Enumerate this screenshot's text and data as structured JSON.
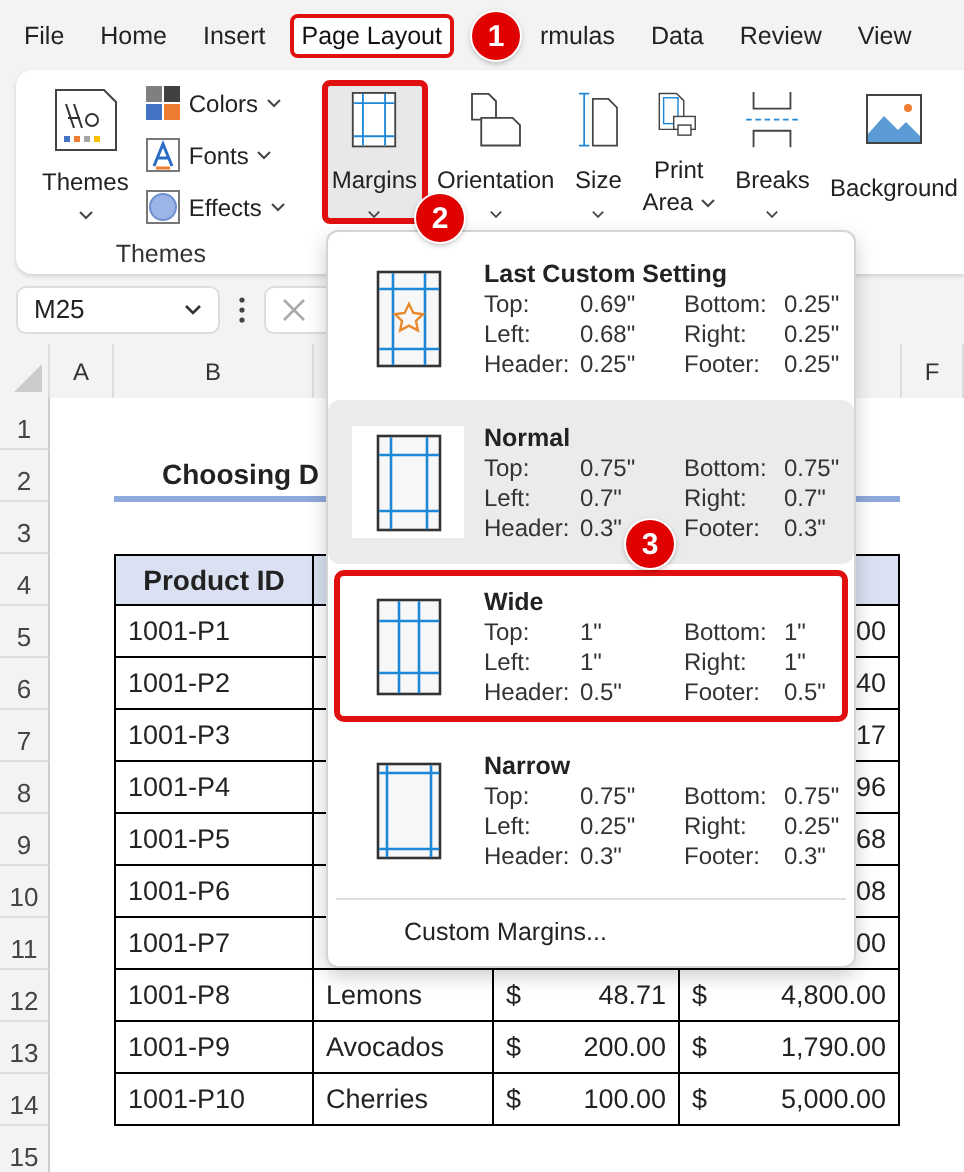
{
  "tabs": [
    {
      "label": "File",
      "selected": false,
      "highlighted": false
    },
    {
      "label": "Home",
      "selected": false,
      "highlighted": false
    },
    {
      "label": "Insert",
      "selected": false,
      "highlighted": false
    },
    {
      "label": "Page Layout",
      "selected": true,
      "highlighted": true
    },
    {
      "label": "rmulas",
      "selected": false,
      "highlighted": false
    },
    {
      "label": "Data",
      "selected": false,
      "highlighted": false
    },
    {
      "label": "Review",
      "selected": false,
      "highlighted": false
    },
    {
      "label": "View",
      "selected": false,
      "highlighted": false
    }
  ],
  "ribbon": {
    "theme_group": {
      "label": "Themes",
      "big_button": {
        "label": "Themes"
      },
      "small_buttons": [
        {
          "label": "Colors",
          "kind": "colors"
        },
        {
          "label": "Fonts",
          "kind": "fonts"
        },
        {
          "label": "Effects",
          "kind": "effects"
        }
      ]
    },
    "page_setup": [
      {
        "lines": [
          "Margins"
        ],
        "kind": "margins",
        "highlighted": true,
        "caret": true
      },
      {
        "lines": [
          "Orientation"
        ],
        "kind": "orientation",
        "highlighted": false,
        "caret": true
      },
      {
        "lines": [
          "Size"
        ],
        "kind": "size",
        "highlighted": false,
        "caret": true
      },
      {
        "lines": [
          "Print",
          "Area"
        ],
        "kind": "print_area",
        "highlighted": false,
        "caret": true
      },
      {
        "lines": [
          "Breaks"
        ],
        "kind": "breaks",
        "highlighted": false,
        "caret": true
      },
      {
        "lines": [
          "Background"
        ],
        "kind": "background",
        "highlighted": false,
        "caret": false
      }
    ]
  },
  "name_box": "M25",
  "columns": [
    {
      "label": "A"
    },
    {
      "label": "B"
    },
    {
      "label": "F"
    }
  ],
  "sheet_rows": [
    {
      "number": "1",
      "kind": "blank"
    },
    {
      "number": "2",
      "kind": "title",
      "text": "Choosing D"
    },
    {
      "number": "3",
      "kind": "blank"
    },
    {
      "number": "4",
      "kind": "header",
      "text": "Product ID"
    },
    {
      "number": "5",
      "kind": "record",
      "id": "1001-P1",
      "total": "00"
    },
    {
      "number": "6",
      "kind": "record",
      "id": "1001-P2",
      "total": "40"
    },
    {
      "number": "7",
      "kind": "record",
      "id": "1001-P3",
      "total": "17"
    },
    {
      "number": "8",
      "kind": "record",
      "id": "1001-P4",
      "total": "96"
    },
    {
      "number": "9",
      "kind": "record",
      "id": "1001-P5",
      "total": "68"
    },
    {
      "number": "10",
      "kind": "record",
      "id": "1001-P6",
      "total": "08"
    },
    {
      "number": "11",
      "kind": "record",
      "id": "1001-P7",
      "total": "00"
    },
    {
      "number": "12",
      "kind": "record",
      "id": "1001-P8",
      "product": "Lemons",
      "price_currency": "$",
      "price": "48.71",
      "total_currency": "$",
      "total": "4,800.00"
    },
    {
      "number": "13",
      "kind": "record",
      "id": "1001-P9",
      "product": "Avocados",
      "price_currency": "$",
      "price": "200.00",
      "total_currency": "$",
      "total": "1,790.00"
    },
    {
      "number": "14",
      "kind": "record",
      "id": "1001-P10",
      "product": "Cherries",
      "price_currency": "$",
      "price": "100.00",
      "total_currency": "$",
      "total": "5,000.00"
    },
    {
      "number": "15",
      "kind": "blank"
    }
  ],
  "margins_menu": {
    "presets": [
      {
        "name": "Last Custom Setting",
        "kind": "custom",
        "hovered": false,
        "highlighted": false,
        "values": [
          {
            "label": "Top:",
            "value": "0.69\""
          },
          {
            "label": "Bottom:",
            "value": "0.25\""
          },
          {
            "label": "Left:",
            "value": "0.68\""
          },
          {
            "label": "Right:",
            "value": "0.25\""
          },
          {
            "label": "Header:",
            "value": "0.25\""
          },
          {
            "label": "Footer:",
            "value": "0.25\""
          }
        ]
      },
      {
        "name": "Normal",
        "kind": "normal",
        "hovered": true,
        "highlighted": false,
        "values": [
          {
            "label": "Top:",
            "value": "0.75\""
          },
          {
            "label": "Bottom:",
            "value": "0.75\""
          },
          {
            "label": "Left:",
            "value": "0.7\""
          },
          {
            "label": "Right:",
            "value": "0.7\""
          },
          {
            "label": "Header:",
            "value": "0.3\""
          },
          {
            "label": "Footer:",
            "value": "0.3\""
          }
        ]
      },
      {
        "name": "Wide",
        "kind": "wide",
        "hovered": false,
        "highlighted": true,
        "values": [
          {
            "label": "Top:",
            "value": "1\""
          },
          {
            "label": "Bottom:",
            "value": "1\""
          },
          {
            "label": "Left:",
            "value": "1\""
          },
          {
            "label": "Right:",
            "value": "1\""
          },
          {
            "label": "Header:",
            "value": "0.5\""
          },
          {
            "label": "Footer:",
            "value": "0.5\""
          }
        ]
      },
      {
        "name": "Narrow",
        "kind": "narrow",
        "hovered": false,
        "highlighted": false,
        "values": [
          {
            "label": "Top:",
            "value": "0.75\""
          },
          {
            "label": "Bottom:",
            "value": "0.75\""
          },
          {
            "label": "Left:",
            "value": "0.25\""
          },
          {
            "label": "Right:",
            "value": "0.25\""
          },
          {
            "label": "Header:",
            "value": "0.3\""
          },
          {
            "label": "Footer:",
            "value": "0.3\""
          }
        ]
      }
    ],
    "footer": "Custom Margins..."
  },
  "callouts": [
    {
      "label": "1"
    },
    {
      "label": "2"
    },
    {
      "label": "3"
    }
  ]
}
